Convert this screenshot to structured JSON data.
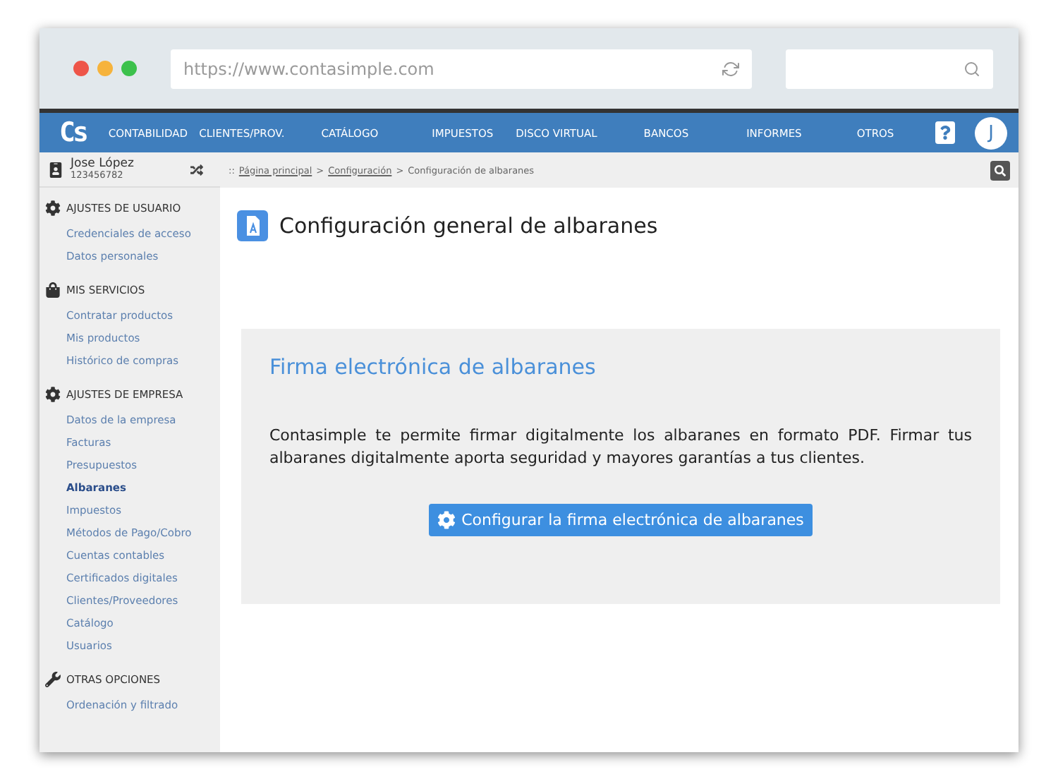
{
  "browser": {
    "url": "https://www.contasimple.com"
  },
  "navbar": {
    "logo": "Cs",
    "items": [
      "CONTABILIDAD",
      "CLIENTES/PROV.",
      "CATÁLOGO",
      "IMPUESTOS",
      "DISCO VIRTUAL",
      "BANCOS",
      "INFORMES",
      "OTROS"
    ],
    "avatar": "J"
  },
  "user": {
    "name": "Jose López",
    "id": "123456782"
  },
  "breadcrumb": {
    "prefix": "::",
    "links": [
      "Página principal",
      "Configuración"
    ],
    "separators": [
      ">",
      ">"
    ],
    "current": "Configuración de albaranes"
  },
  "sidebar": {
    "sections": [
      {
        "title": "AJUSTES DE USUARIO",
        "items": [
          {
            "label": "Credenciales de acceso",
            "selected": false
          },
          {
            "label": "Datos personales",
            "selected": false
          }
        ]
      },
      {
        "title": "MIS SERVICIOS",
        "items": [
          {
            "label": "Contratar productos",
            "selected": false
          },
          {
            "label": "Mis productos",
            "selected": false
          },
          {
            "label": "Histórico de compras",
            "selected": false
          }
        ]
      },
      {
        "title": "AJUSTES DE EMPRESA",
        "items": [
          {
            "label": "Datos de la empresa",
            "selected": false
          },
          {
            "label": "Facturas",
            "selected": false
          },
          {
            "label": "Presupuestos",
            "selected": false
          },
          {
            "label": "Albaranes",
            "selected": true
          },
          {
            "label": "Impuestos",
            "selected": false
          },
          {
            "label": "Métodos de Pago/Cobro",
            "selected": false
          },
          {
            "label": "Cuentas contables",
            "selected": false
          },
          {
            "label": "Certificados digitales",
            "selected": false
          },
          {
            "label": "Clientes/Proveedores",
            "selected": false
          },
          {
            "label": "Catálogo",
            "selected": false
          },
          {
            "label": "Usuarios",
            "selected": false
          }
        ]
      },
      {
        "title": "OTRAS OPCIONES",
        "items": [
          {
            "label": "Ordenación y filtrado",
            "selected": false
          }
        ]
      }
    ]
  },
  "page": {
    "title": "Configuración general de albaranes"
  },
  "card": {
    "title": "Firma electrónica de albaranes",
    "text": "Contasimple te permite firmar digitalmente los albaranes en formato PDF. Firmar tus albaranes digitalmente aporta seguridad y mayores garantías a tus clientes.",
    "button": "Configurar la firma electrónica de albaranes"
  }
}
